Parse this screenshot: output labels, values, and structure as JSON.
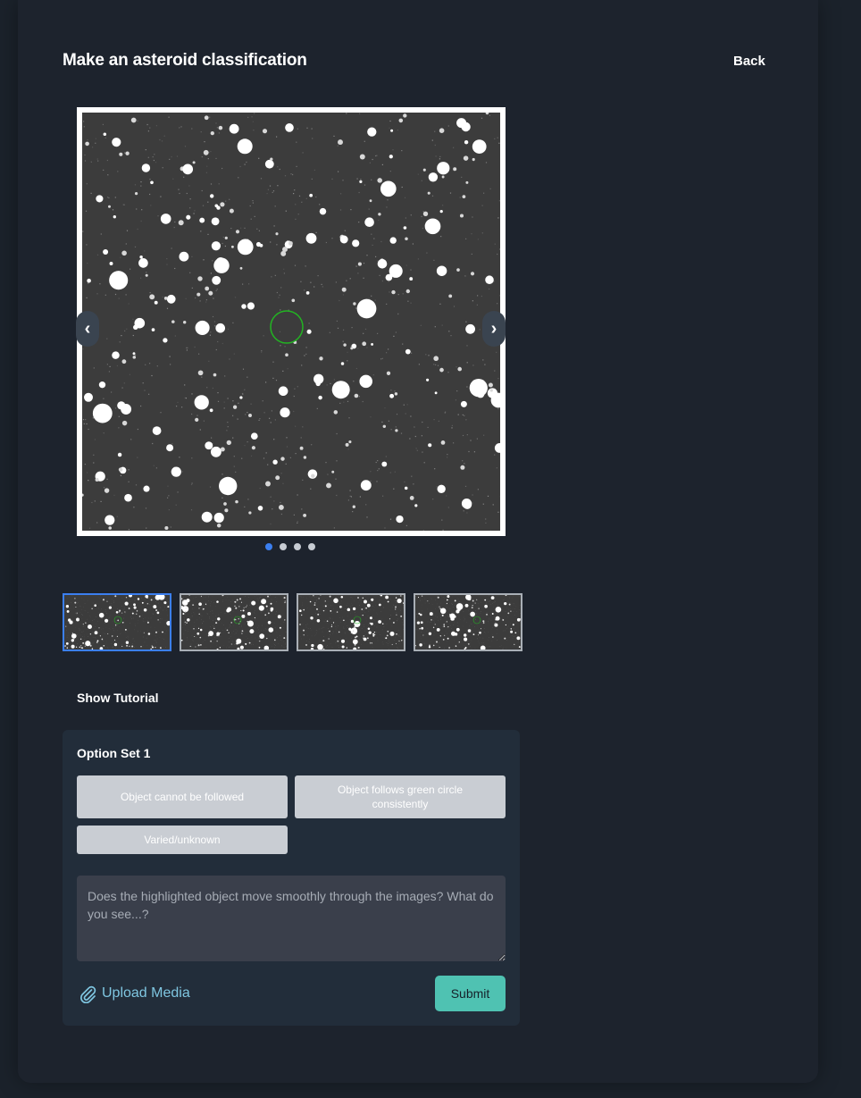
{
  "header": {
    "title": "Make an asteroid classification",
    "back_label": "Back"
  },
  "viewer": {
    "prev_label": "‹",
    "next_label": "›",
    "slide_count": 4,
    "active_slide": 1
  },
  "thumbnails": {
    "count": 4,
    "active_index": 0
  },
  "tutorial_label": "Show Tutorial",
  "options": {
    "set_title": "Option Set 1",
    "items": [
      "Object cannot be followed",
      "Object follows green circle consistently",
      "Varied/unknown"
    ]
  },
  "comment": {
    "placeholder": "Does the highlighted object move smoothly through the images? What do you see...?"
  },
  "upload_label": "Upload Media",
  "submit_label": "Submit",
  "colors": {
    "accent": "#3b7ff0",
    "submit": "#4fc2b2",
    "upload": "#7fc6e1",
    "marker": "#22b422"
  }
}
